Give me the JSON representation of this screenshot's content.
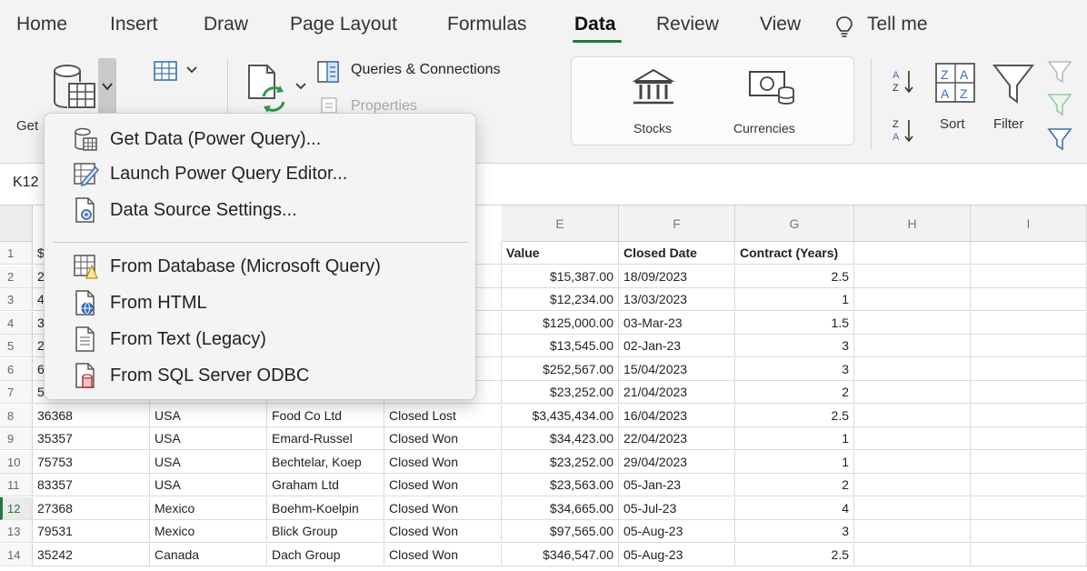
{
  "tabs": [
    {
      "label": "Home"
    },
    {
      "label": "Insert"
    },
    {
      "label": "Draw"
    },
    {
      "label": "Page Layout"
    },
    {
      "label": "Formulas"
    },
    {
      "label": "Data",
      "active": true
    },
    {
      "label": "Review"
    },
    {
      "label": "View"
    },
    {
      "label": "Tell me"
    }
  ],
  "ribbon": {
    "get_data_label": "Get",
    "queries_label": "Queries & Connections",
    "properties_label": "Properties",
    "stocks_label": "Stocks",
    "currencies_label": "Currencies",
    "sort_label": "Sort",
    "filter_label": "Filter"
  },
  "name_box": "K12",
  "dropdown": {
    "items": [
      {
        "label": "Get Data (Power Query)...",
        "icon": "database-sheet-icon"
      },
      {
        "label": "Launch Power Query Editor...",
        "icon": "query-editor-icon"
      },
      {
        "label": "Data Source Settings...",
        "icon": "data-source-settings-icon"
      },
      {
        "label": "From Database (Microsoft Query)",
        "icon": "microsoft-query-icon"
      },
      {
        "label": "From HTML",
        "icon": "html-globe-icon"
      },
      {
        "label": "From Text (Legacy)",
        "icon": "text-file-icon"
      },
      {
        "label": "From SQL Server ODBC",
        "icon": "sql-odbc-icon"
      }
    ]
  },
  "grid": {
    "columns": [
      "E",
      "F",
      "G",
      "H",
      "I"
    ],
    "header_row": {
      "value": "Value",
      "closed_date": "Closed Date",
      "contract": "Contract (Years)"
    },
    "rows": [
      {
        "n": "1",
        "a": "$",
        "b": "",
        "c": "",
        "d": "",
        "e": "",
        "f": "",
        "g": ""
      },
      {
        "n": "2",
        "a": "2",
        "b": "",
        "c": "",
        "d": "",
        "e": "$15,387.00",
        "f": "18/09/2023",
        "g": "2.5"
      },
      {
        "n": "3",
        "a": "4",
        "b": "",
        "c": "",
        "d": "",
        "e": "$12,234.00",
        "f": "13/03/2023",
        "g": "1"
      },
      {
        "n": "4",
        "a": "3",
        "b": "",
        "c": "",
        "d": "",
        "e": "$125,000.00",
        "f": "03-Mar-23",
        "g": "1.5"
      },
      {
        "n": "5",
        "a": "2",
        "b": "",
        "c": "",
        "d": "",
        "e": "$13,545.00",
        "f": "02-Jan-23",
        "g": "3"
      },
      {
        "n": "6",
        "a": "6",
        "b": "",
        "c": "",
        "d": "",
        "e": "$252,567.00",
        "f": "15/04/2023",
        "g": "3"
      },
      {
        "n": "7",
        "a": "5",
        "b": "",
        "c": "",
        "d": "",
        "e": "$23,252.00",
        "f": "21/04/2023",
        "g": "2"
      },
      {
        "n": "8",
        "a": "36368",
        "b": "USA",
        "c": "Food Co Ltd",
        "d": "Closed Lost",
        "e": "$3,435,434.00",
        "f": "16/04/2023",
        "g": "2.5"
      },
      {
        "n": "9",
        "a": "35357",
        "b": "USA",
        "c": "Emard-Russel",
        "d": "Closed Won",
        "e": "$34,423.00",
        "f": "22/04/2023",
        "g": "1"
      },
      {
        "n": "10",
        "a": "75753",
        "b": "USA",
        "c": "Bechtelar, Koep",
        "d": "Closed Won",
        "e": "$23,252.00",
        "f": "29/04/2023",
        "g": "1"
      },
      {
        "n": "11",
        "a": "83357",
        "b": "USA",
        "c": "Graham Ltd",
        "d": "Closed Won",
        "e": "$23,563.00",
        "f": "05-Jan-23",
        "g": "2"
      },
      {
        "n": "12",
        "a": "27368",
        "b": "Mexico",
        "c": "Boehm-Koelpin",
        "d": "Closed Won",
        "e": "$34,665.00",
        "f": "05-Jul-23",
        "g": "4"
      },
      {
        "n": "13",
        "a": "79531",
        "b": "Mexico",
        "c": "Blick Group",
        "d": "Closed Won",
        "e": "$97,565.00",
        "f": "05-Aug-23",
        "g": "3"
      },
      {
        "n": "14",
        "a": "35242",
        "b": "Canada",
        "c": "Dach Group",
        "d": "Closed Won",
        "e": "$346,547.00",
        "f": "05-Aug-23",
        "g": "2.5"
      }
    ]
  },
  "colors": {
    "accent_green": "#1d7a3e",
    "ribbon_bg": "#f3f3f3"
  }
}
